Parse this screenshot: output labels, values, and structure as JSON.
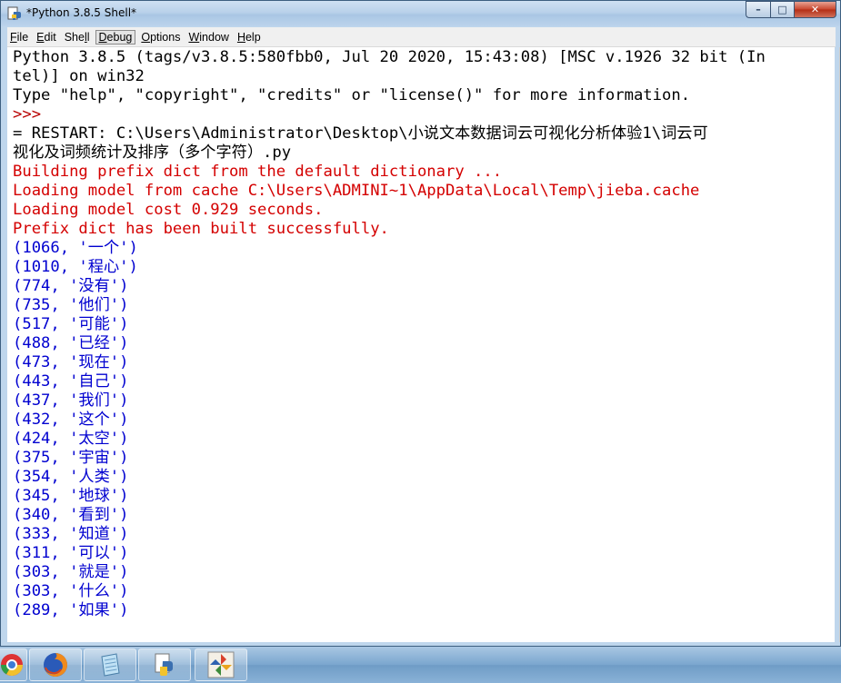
{
  "window": {
    "title": "*Python 3.8.5 Shell*",
    "controls": {
      "minimize": "–",
      "maximize": "□",
      "close": "✕"
    }
  },
  "menu": {
    "items": [
      {
        "accel": "F",
        "rest": "ile"
      },
      {
        "accel": "E",
        "rest": "dit"
      },
      {
        "pre": "She",
        "accel": "l",
        "rest": "l"
      },
      {
        "accel": "D",
        "rest": "ebug"
      },
      {
        "accel": "O",
        "rest": "ptions"
      },
      {
        "accel": "W",
        "rest": "indow"
      },
      {
        "accel": "H",
        "rest": "elp"
      }
    ]
  },
  "shell": {
    "lines": [
      {
        "text": "Python 3.8.5 (tags/v3.8.5:580fbb0, Jul 20 2020, 15:43:08) [MSC v.1926 32 bit (In",
        "kind": "out"
      },
      {
        "text": "tel)] on win32",
        "kind": "out"
      },
      {
        "text": "Type \"help\", \"copyright\", \"credits\" or \"license()\" for more information.",
        "kind": "out"
      },
      {
        "text": ">>> ",
        "kind": "prompt"
      },
      {
        "text": "= RESTART: C:\\Users\\Administrator\\Desktop\\小说文本数据词云可视化分析体验1\\词云可",
        "kind": "out"
      },
      {
        "text": "视化及词频统计及排序（多个字符）.py",
        "kind": "out"
      },
      {
        "text": "Building prefix dict from the default dictionary ...",
        "kind": "err"
      },
      {
        "text": "Loading model from cache C:\\Users\\ADMINI~1\\AppData\\Local\\Temp\\jieba.cache",
        "kind": "err"
      },
      {
        "text": "Loading model cost 0.929 seconds.",
        "kind": "err"
      },
      {
        "text": "Prefix dict has been built successfully.",
        "kind": "err"
      },
      {
        "text": "(1066, '一个')",
        "kind": "tuple"
      },
      {
        "text": "(1010, '程心')",
        "kind": "tuple"
      },
      {
        "text": "(774, '没有')",
        "kind": "tuple"
      },
      {
        "text": "(735, '他们')",
        "kind": "tuple"
      },
      {
        "text": "(517, '可能')",
        "kind": "tuple"
      },
      {
        "text": "(488, '已经')",
        "kind": "tuple"
      },
      {
        "text": "(473, '现在')",
        "kind": "tuple"
      },
      {
        "text": "(443, '自己')",
        "kind": "tuple"
      },
      {
        "text": "(437, '我们')",
        "kind": "tuple"
      },
      {
        "text": "(432, '这个')",
        "kind": "tuple"
      },
      {
        "text": "(424, '太空')",
        "kind": "tuple"
      },
      {
        "text": "(375, '宇宙')",
        "kind": "tuple"
      },
      {
        "text": "(354, '人类')",
        "kind": "tuple"
      },
      {
        "text": "(345, '地球')",
        "kind": "tuple"
      },
      {
        "text": "(340, '看到')",
        "kind": "tuple"
      },
      {
        "text": "(333, '知道')",
        "kind": "tuple"
      },
      {
        "text": "(311, '可以')",
        "kind": "tuple"
      },
      {
        "text": "(303, '就是')",
        "kind": "tuple"
      },
      {
        "text": "(303, '什么')",
        "kind": "tuple"
      },
      {
        "text": "(289, '如果')",
        "kind": "tuple"
      }
    ]
  },
  "taskbar": {
    "apps": [
      {
        "icon": "chrome-icon"
      },
      {
        "icon": "firefox-icon"
      },
      {
        "icon": "notepad-icon"
      },
      {
        "icon": "python-idle-icon"
      },
      {
        "icon": "pinwheel-app-icon"
      }
    ]
  },
  "colors": {
    "stdout": "#000000",
    "stderr": "#d40000",
    "prompt": "#b80000",
    "result": "#0000d0"
  }
}
